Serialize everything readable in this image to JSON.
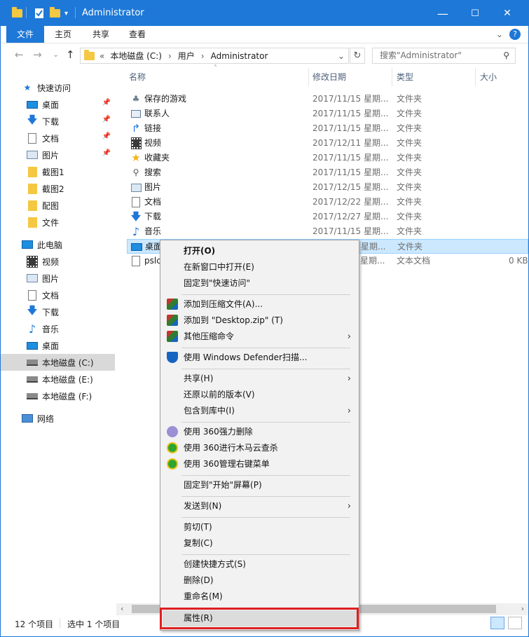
{
  "window": {
    "title": "Administrator"
  },
  "titlebar": {
    "minimize": "—",
    "maximize": "☐",
    "close": "✕"
  },
  "ribbon": {
    "tabs": [
      "文件",
      "主页",
      "共享",
      "查看"
    ],
    "expand": "⌄",
    "help": "?"
  },
  "nav": {
    "back": "←",
    "forward": "→",
    "dropdown": "⌄",
    "up": "↑",
    "breadcrumb": [
      "本地磁盘 (C:)",
      "用户",
      "Administrator"
    ],
    "overflow": "«",
    "refresh": "↻",
    "search_placeholder": "搜索\"Administrator\"",
    "search_icon": "⚲"
  },
  "sidebar": {
    "quick_access": "快速访问",
    "quick_items": [
      {
        "label": "桌面",
        "pinned": true
      },
      {
        "label": "下载",
        "pinned": true
      },
      {
        "label": "文档",
        "pinned": true
      },
      {
        "label": "图片",
        "pinned": true
      },
      {
        "label": "截图1",
        "pinned": false
      },
      {
        "label": "截图2",
        "pinned": false
      },
      {
        "label": "配图",
        "pinned": false
      },
      {
        "label": "文件",
        "pinned": false
      }
    ],
    "this_pc": "此电脑",
    "pc_items": [
      "视频",
      "图片",
      "文档",
      "下载",
      "音乐",
      "桌面",
      "本地磁盘 (C:)",
      "本地磁盘 (E:)",
      "本地磁盘 (F:)"
    ],
    "network": "网络"
  },
  "columns": {
    "name": "名称",
    "date": "修改日期",
    "type": "类型",
    "size": "大小"
  },
  "files": [
    {
      "name": "保存的游戏",
      "date": "2017/11/15 星期...",
      "type": "文件夹",
      "size": ""
    },
    {
      "name": "联系人",
      "date": "2017/11/15 星期...",
      "type": "文件夹",
      "size": ""
    },
    {
      "name": "链接",
      "date": "2017/11/15 星期...",
      "type": "文件夹",
      "size": ""
    },
    {
      "name": "视频",
      "date": "2017/12/11 星期...",
      "type": "文件夹",
      "size": ""
    },
    {
      "name": "收藏夹",
      "date": "2017/11/15 星期...",
      "type": "文件夹",
      "size": ""
    },
    {
      "name": "搜索",
      "date": "2017/11/15 星期...",
      "type": "文件夹",
      "size": ""
    },
    {
      "name": "图片",
      "date": "2017/12/15 星期...",
      "type": "文件夹",
      "size": ""
    },
    {
      "name": "文档",
      "date": "2017/12/22 星期...",
      "type": "文件夹",
      "size": ""
    },
    {
      "name": "下载",
      "date": "2017/12/27 星期...",
      "type": "文件夹",
      "size": ""
    },
    {
      "name": "音乐",
      "date": "2017/11/15 星期...",
      "type": "文件夹",
      "size": ""
    },
    {
      "name": "桌面",
      "date": "星期...",
      "type": "文件夹",
      "size": ""
    },
    {
      "name": "pslc",
      "date": "星期...",
      "type": "文本文档",
      "size": "0 KB"
    }
  ],
  "context_menu": {
    "open": "打开(O)",
    "open_new_window": "在新窗口中打开(E)",
    "pin_quick": "固定到\"快速访问\"",
    "add_archive": "添加到压缩文件(A)...",
    "add_zip": "添加到 \"Desktop.zip\" (T)",
    "other_compress": "其他压缩命令",
    "defender": "使用 Windows Defender扫描...",
    "share": "共享(H)",
    "restore": "还原以前的版本(V)",
    "include_library": "包含到库中(I)",
    "force_delete": "使用 360强力删除",
    "trojan_scan": "使用 360进行木马云查杀",
    "right_menu": "使用 360管理右键菜单",
    "pin_start": "固定到\"开始\"屏幕(P)",
    "send_to": "发送到(N)",
    "cut": "剪切(T)",
    "copy": "复制(C)",
    "shortcut": "创建快捷方式(S)",
    "delete": "删除(D)",
    "rename": "重命名(M)",
    "properties": "属性(R)"
  },
  "status": {
    "count": "12 个项目",
    "selected": "选中 1 个项目"
  },
  "colors": {
    "accent": "#1e78d7",
    "highlight": "#e02020",
    "selection": "#cce8ff"
  }
}
